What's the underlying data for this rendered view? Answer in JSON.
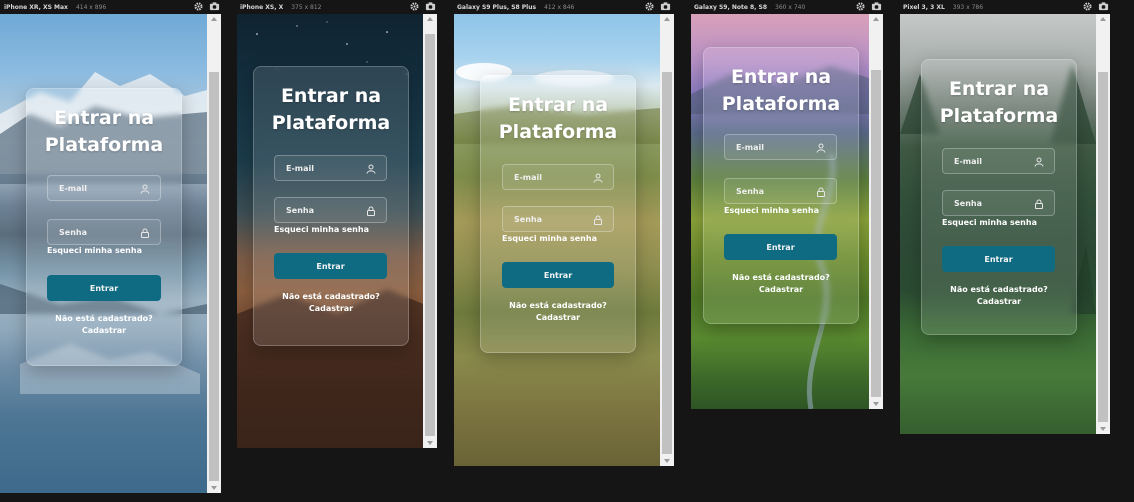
{
  "devices": [
    {
      "name": "iPhone XR, XS Max",
      "size": "414 x 896"
    },
    {
      "name": "iPhone XS, X",
      "size": "375 x 812"
    },
    {
      "name": "Galaxy S9 Plus, S8 Plus",
      "size": "412 x 846"
    },
    {
      "name": "Galaxy S9, Note 8, S8",
      "size": "360 x 740"
    },
    {
      "name": "Pixel 3, 3 XL",
      "size": "393 x 786"
    }
  ],
  "login": {
    "title_line1": "Entrar na",
    "title_line2": "Plataforma",
    "email_label": "E-mail",
    "password_label": "Senha",
    "forgot": "Esqueci minha senha",
    "button": "Entrar",
    "no_account": "Não está cadastrado?",
    "register": "Cadastrar"
  },
  "icons": {
    "settings": "gear-icon",
    "screenshot": "camera-icon",
    "email_field": "user-icon",
    "password_field": "lock-icon"
  },
  "colors": {
    "primary_button": "#0f6b82",
    "page_background": "#151515",
    "scrollbar_track": "#f1f1f1",
    "scrollbar_thumb": "#c1c1c1"
  }
}
